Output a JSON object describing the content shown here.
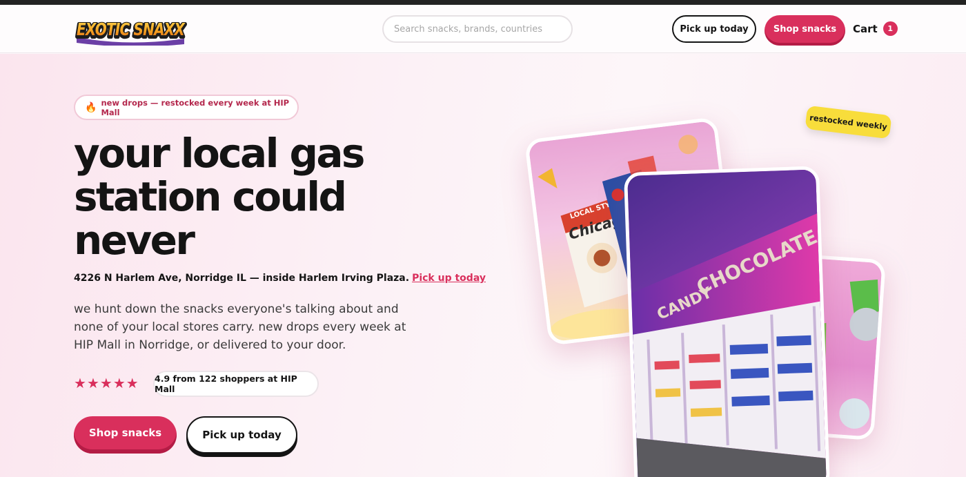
{
  "header": {
    "logo_text": "EXOTIC SNAXX",
    "search_placeholder": "Search snacks, brands, countries",
    "pickup_label": "Pick up today",
    "shop_label": "Shop snacks",
    "cart_label": "Cart",
    "cart_count": "1"
  },
  "hero": {
    "badge_icon": "fire-icon",
    "badge_text": "new drops — restocked every week at HIP Mall",
    "headline_lines": [
      "your local gas",
      "station could",
      "never"
    ],
    "address_text": "4226 N Harlem Ave, Norridge IL — inside Harlem Irving Plaza.",
    "address_link": "Pick up today",
    "description": "we hunt down the snacks everyone's talking about and none of your local stores carry. new drops every week at HIP Mall in Norridge, or delivered to your door.",
    "rating_stars": 5,
    "rating_text": "4.9 from 122 shoppers at HIP Mall",
    "cta_primary": "Shop snacks",
    "cta_secondary": "Pick up today"
  },
  "gallery": {
    "restock_tag": "restocked weekly",
    "photos": [
      {
        "name": "chicago-chips-photo",
        "text": [
          "LOCAL STYLE",
          "Chicago"
        ]
      },
      {
        "name": "candy-store-photo",
        "text": [
          "CANDY",
          "CHOCOLATE"
        ]
      },
      {
        "name": "snack-side-photo"
      }
    ]
  },
  "colors": {
    "accent": "#d92f5c",
    "accent_dark": "#b41c45",
    "ink": "#141414",
    "tag_yellow": "#f8dd3b"
  }
}
